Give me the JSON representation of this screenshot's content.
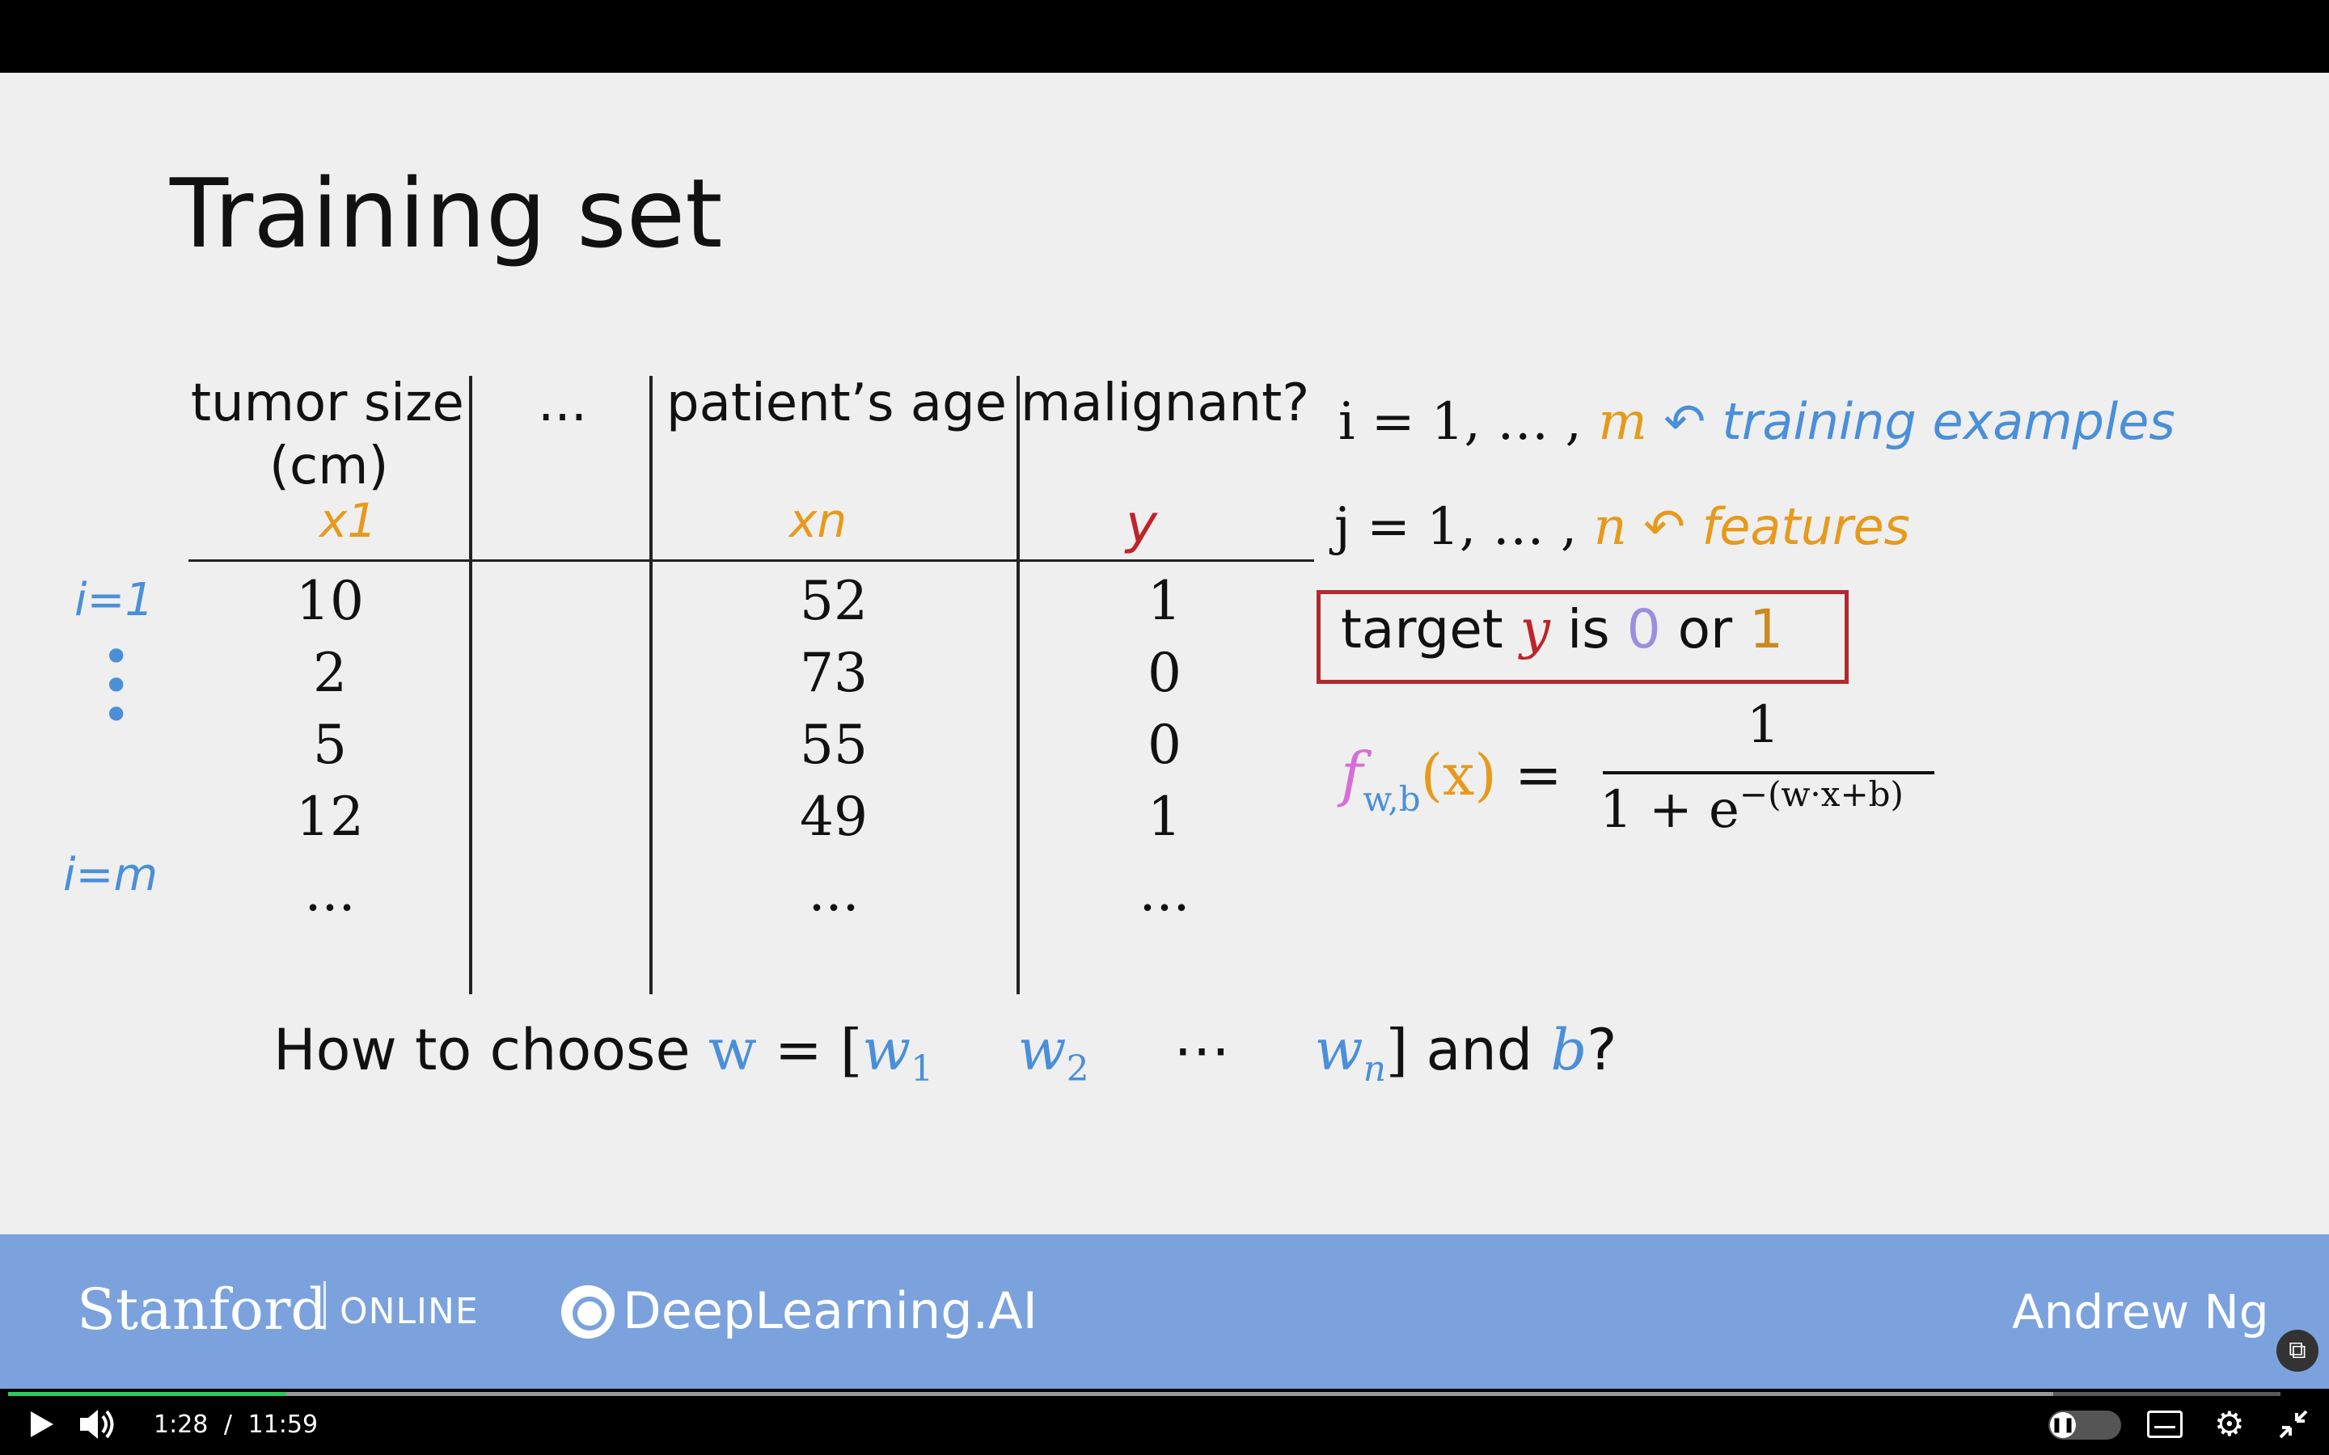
{
  "slide": {
    "title": "Training set",
    "table": {
      "headers": [
        {
          "label": "tumor size",
          "unit": "(cm)",
          "symbol": "x1"
        },
        {
          "label": "...",
          "symbol": ""
        },
        {
          "label": "patient’s age",
          "symbol": "xn"
        },
        {
          "label": "malignant?",
          "symbol": "y"
        }
      ],
      "row_labels": {
        "first": "i=1",
        "last": "i=m"
      },
      "rows": [
        [
          "10",
          "52",
          "1"
        ],
        [
          "2",
          "73",
          "0"
        ],
        [
          "5",
          "55",
          "0"
        ],
        [
          "12",
          "49",
          "1"
        ],
        [
          "...",
          "...",
          "..."
        ]
      ]
    },
    "notes": {
      "line1_prefix": "i = 1, … ,",
      "line1_var": "m",
      "line1_annotation": "training examples",
      "line2_prefix": "j = 1, … ,",
      "line2_var": "n",
      "line2_annotation": "features"
    },
    "target": {
      "prefix": "target",
      "var": "y",
      "mid": "is",
      "zero": "0",
      "or": "or",
      "one": "1"
    },
    "formula": {
      "f": "f",
      "sub": "w,b",
      "arg": "(x)",
      "eq": "=",
      "numerator": "1",
      "denominator": "1 + e",
      "exponent": "−(w·x+b)"
    },
    "question": {
      "prefix": "How to choose",
      "w": "w",
      "eq": "= [",
      "w1": "w",
      "w1sub": "1",
      "w2": "w",
      "w2sub": "2",
      "dots": "⋯",
      "wn": "w",
      "wnsub": "n",
      "close": "]",
      "and": "and",
      "b": "b",
      "qmark": "?"
    }
  },
  "footer": {
    "stanford": "Stanford",
    "online": "ONLINE",
    "dlai": "DeepLearning.AI",
    "presenter": "Andrew Ng"
  },
  "player": {
    "current_time": "1:28",
    "separator": "/",
    "duration": "11:59",
    "progress_fraction": 0.1224,
    "buffer_fraction": 0.9
  },
  "colors": {
    "accent_blue": "#4a8fd8",
    "accent_orange": "#e69a1c",
    "accent_red": "#c0222a",
    "footer_bg": "#7ba2dc",
    "progress": "#2ec95c"
  }
}
